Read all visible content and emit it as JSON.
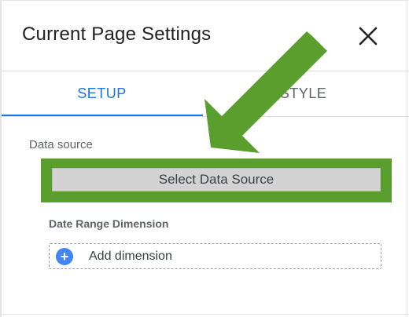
{
  "header": {
    "title": "Current Page Settings",
    "close_icon": "close-icon"
  },
  "tabs": [
    {
      "label": "SETUP",
      "active": true
    },
    {
      "label": "STYLE",
      "active": false
    }
  ],
  "data_source": {
    "label": "Data source",
    "button_label": "Select Data Source"
  },
  "date_range": {
    "label": "Date Range Dimension",
    "add_label": "Add dimension",
    "add_icon": "plus-icon"
  },
  "annotation": {
    "icon": "arrow-annotation",
    "color": "#5a9e2d"
  },
  "colors": {
    "accent": "#1a73e8",
    "highlight": "#5a9e2d"
  }
}
